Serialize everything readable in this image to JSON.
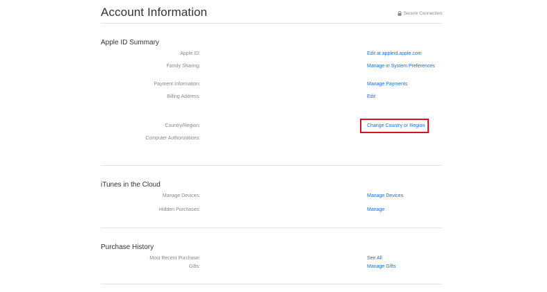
{
  "header": {
    "title": "Account Information",
    "secure_label": "Secure Connection",
    "secure_icon": "lock-icon"
  },
  "summary": {
    "title": "Apple ID Summary",
    "rows": [
      {
        "label": "Apple ID:",
        "action": "Edit at appleid.apple.com"
      },
      {
        "label": "Family Sharing:",
        "action": "Manage in System Preferences"
      },
      {
        "label": "Payment Information:",
        "action": "Manage Payments"
      },
      {
        "label": "Billing Address:",
        "action": "Edit"
      },
      {
        "label": "Country/Region:",
        "action": "Change Country or Region"
      },
      {
        "label": "Computer Authorizations:",
        "action": ""
      }
    ]
  },
  "cloud": {
    "title": "iTunes in the Cloud",
    "rows": [
      {
        "label": "Manage Devices:",
        "action": "Manage Devices"
      },
      {
        "label": "Hidden Purchases:",
        "action": "Manage"
      }
    ]
  },
  "history": {
    "title": "Purchase History",
    "rows": [
      {
        "label": "Most Recent Purchase:",
        "action": "See All"
      },
      {
        "label": "Gifts:",
        "action": "Manage Gifts"
      }
    ]
  },
  "colors": {
    "link": "#1a6dcc",
    "highlight": "#d9121b",
    "label": "#888888",
    "divider": "#e4e4e4"
  }
}
